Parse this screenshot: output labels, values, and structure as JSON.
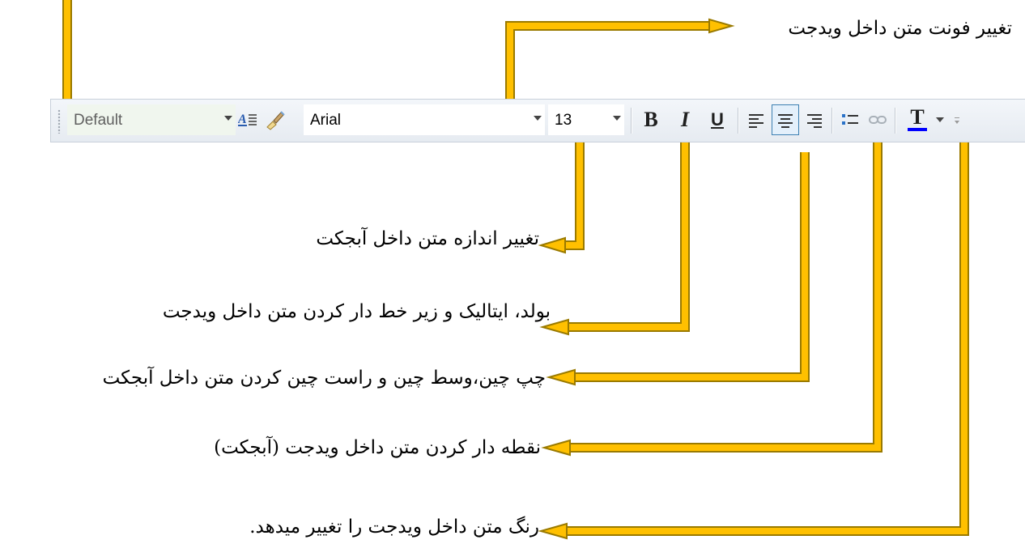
{
  "toolbar": {
    "style_value": "Default",
    "font_value": "Arial",
    "size_value": "13",
    "bold_label": "B",
    "italic_label": "I",
    "underline_label": "U",
    "text_color_label": "T",
    "text_color": "#0000ff",
    "icons": [
      "text-style-icon",
      "format-painter-icon",
      "align-left-icon",
      "align-center-icon",
      "align-right-icon",
      "bullet-list-icon",
      "link-icon",
      "chevron-down-icon",
      "toolbar-options-icon"
    ]
  },
  "annotations": {
    "font": "تغییر فونت متن داخل ویدجت",
    "size": "تغییر اندازه متن داخل آبجکت",
    "style": "بولد، ایتالیک و زیر خط دار کردن متن داخل ویدجت",
    "align": "چپ چین،وسط چین و راست چین کردن متن داخل آبجکت",
    "bullet": "نقطه دار کردن متن داخل ویدجت (آبجکت)",
    "color": "رنگ متن داخل ویدجت را تغییر میدهد."
  },
  "colors": {
    "arrow_fill": "#ffc000",
    "arrow_outline": "#9a7a00",
    "active_border": "#3c7fb1"
  }
}
